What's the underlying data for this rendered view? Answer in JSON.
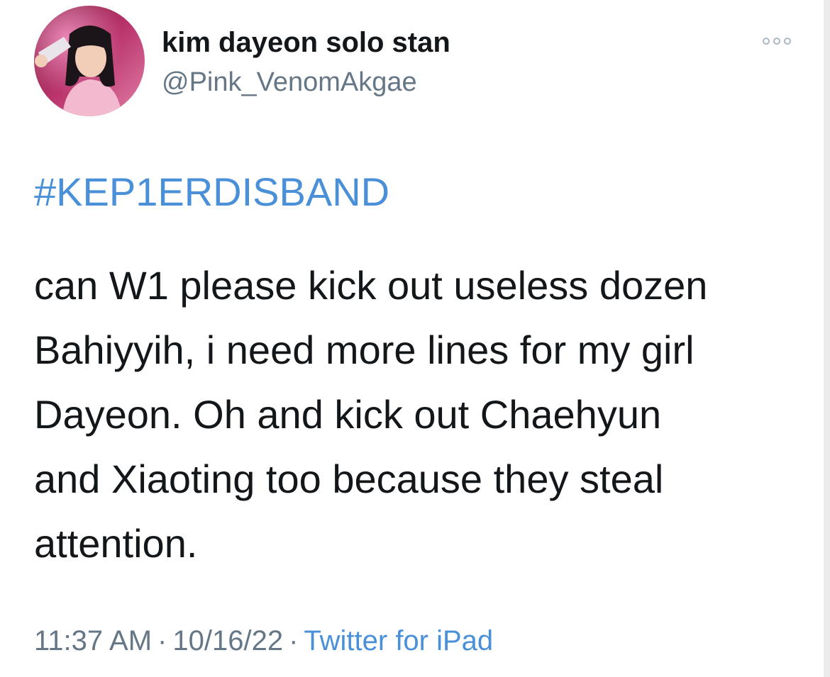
{
  "tweet": {
    "author": {
      "display_name": "kim dayeon solo stan",
      "handle": "@Pink_VenomAkgae",
      "avatar": "profile-photo"
    },
    "more_icon": "more-horizontal-icon",
    "hashtag": "#KEP1ERDISBAND",
    "body_lines": [
      "can W1 please kick out useless dozen",
      "Bahiyyih, i need more lines for my girl",
      "Dayeon. Oh and kick out Chaehyun",
      "and Xiaoting too because they steal",
      "attention."
    ],
    "time": "11:37 AM",
    "separator": "·",
    "date": "10/16/22",
    "source": "Twitter for iPad"
  },
  "colors": {
    "text": "#14171a",
    "secondary": "#657786",
    "link": "#4a90d9",
    "background": "#ffffff"
  }
}
